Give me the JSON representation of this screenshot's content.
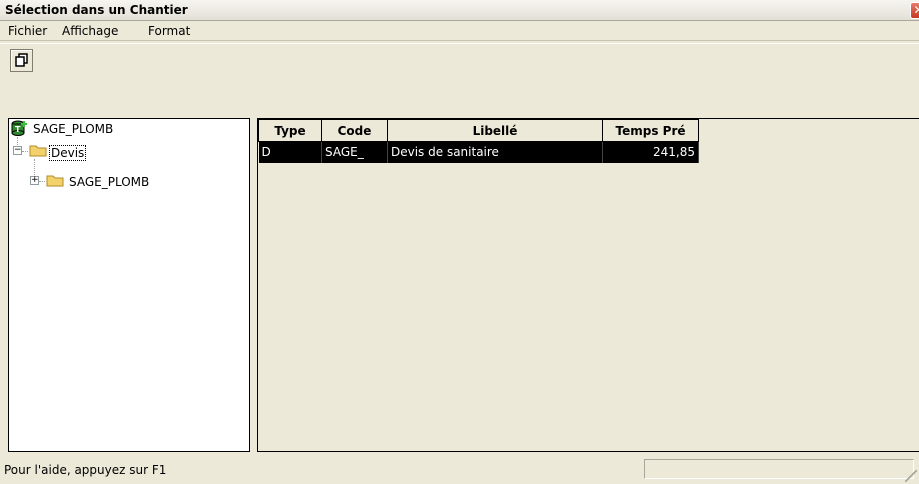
{
  "window": {
    "title": "Sélection dans un Chantier",
    "close_glyph": "✕"
  },
  "menu": {
    "items": [
      "Fichier",
      "Affichage",
      "Format"
    ]
  },
  "toolbar": {
    "button_icon": "copy-window-icon"
  },
  "tree": {
    "root": {
      "label": "SAGE_PLOMB",
      "icon": "database-add-icon"
    },
    "devis": {
      "label": "Devis",
      "expander": "−",
      "icon": "folder-icon"
    },
    "child": {
      "label": "SAGE_PLOMB",
      "expander": "+",
      "icon": "folder-icon"
    }
  },
  "list": {
    "columns": [
      "Type",
      "Code",
      "Libellé",
      "Temps Pré"
    ],
    "rows": [
      {
        "type": "D",
        "code": "SAGE_",
        "libelle": "Devis de sanitaire",
        "temps": "241,85"
      }
    ]
  },
  "status": {
    "text": "Pour l'aide, appuyez sur F1"
  },
  "colors": {
    "selection_bg": "#000000",
    "selection_fg": "#ffffff",
    "folder": "#f3d16b"
  }
}
